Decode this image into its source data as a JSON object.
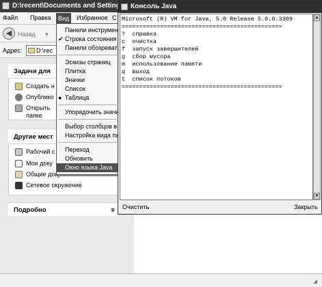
{
  "explorer": {
    "title": "D:\\recent\\Documents and Settings",
    "menu": [
      "Файл",
      "Правка",
      "Вид",
      "Избранное",
      "С"
    ],
    "back_label": "Назад",
    "address_label": "Адрес:",
    "address_value": "D:\\rec"
  },
  "view_menu": {
    "items": [
      {
        "label": "Панели инструмент",
        "check": ""
      },
      {
        "label": "Строка состояния",
        "check": "✔"
      },
      {
        "label": "Панели обозревате",
        "check": ""
      },
      {
        "label": "Эскизы страниц",
        "check": ""
      },
      {
        "label": "Плитка",
        "check": ""
      },
      {
        "label": "Значки",
        "check": ""
      },
      {
        "label": "Список",
        "check": ""
      },
      {
        "label": "Таблица",
        "check": "●"
      },
      {
        "label": "Упорядочить значк",
        "check": ""
      },
      {
        "label": "Выбор столбцов в т",
        "check": ""
      },
      {
        "label": "Настройка вида па",
        "check": ""
      },
      {
        "label": "Переход",
        "check": ""
      },
      {
        "label": "Обновить",
        "check": ""
      },
      {
        "label": "Окно языка Java",
        "check": ""
      }
    ]
  },
  "task_pane": {
    "tasks_title": "Задачи для",
    "tasks": [
      "Создать н",
      "Опублико",
      "Открыть",
      "папке"
    ],
    "places_title": "Другие мест",
    "places": [
      "Рабочий с",
      "Мои доку",
      "Общие документы",
      "Сетевое окружение"
    ],
    "details_title": "Подробно",
    "details_chevron": "»"
  },
  "console": {
    "title": "Консоль Java",
    "lines": [
      "Microsoft (R) VM for Java, 5.0 Release 5.0.0.3309",
      "==============================================",
      "?  справка",
      "c  очистка",
      "f  запуск завершителей",
      "g  сбор мусора",
      "m  использование памяти",
      "q  выход",
      "t  список потоков",
      "=============================================="
    ],
    "clear_label": "Очистить",
    "close_label": "Закрыть"
  },
  "colors": {
    "title_bar": "#3a3a3a",
    "highlight": "#505050"
  }
}
